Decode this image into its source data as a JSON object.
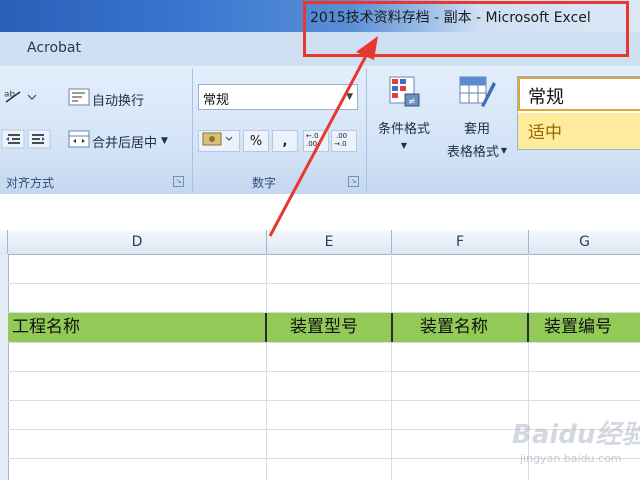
{
  "window": {
    "title": "2015技术资料存档 - 副本 - Microsoft Excel"
  },
  "tabs": {
    "acrobat": "Acrobat"
  },
  "ribbon": {
    "alignment": {
      "wrap_text": "自动换行",
      "merge_center": "合并后居中",
      "group_label": "对齐方式"
    },
    "number": {
      "format_value": "常规",
      "percent": "%",
      "comma": ",",
      "group_label": "数字"
    },
    "styles": {
      "conditional_format": "条件格式",
      "table_format_1": "套用",
      "table_format_2": "表格格式",
      "style_normal": "常规",
      "style_medium": "适中"
    }
  },
  "columns": [
    "D",
    "E",
    "F",
    "G"
  ],
  "header_row": [
    "工程名称",
    "装置型号",
    "装置名称",
    "装置编号"
  ],
  "watermark": {
    "main": "Baidu经验",
    "sub": "jingyan.baidu.com"
  },
  "colors": {
    "highlight": "#e8372f",
    "header_green": "#92c957",
    "style_medium_fill": "#ffeb9c"
  }
}
